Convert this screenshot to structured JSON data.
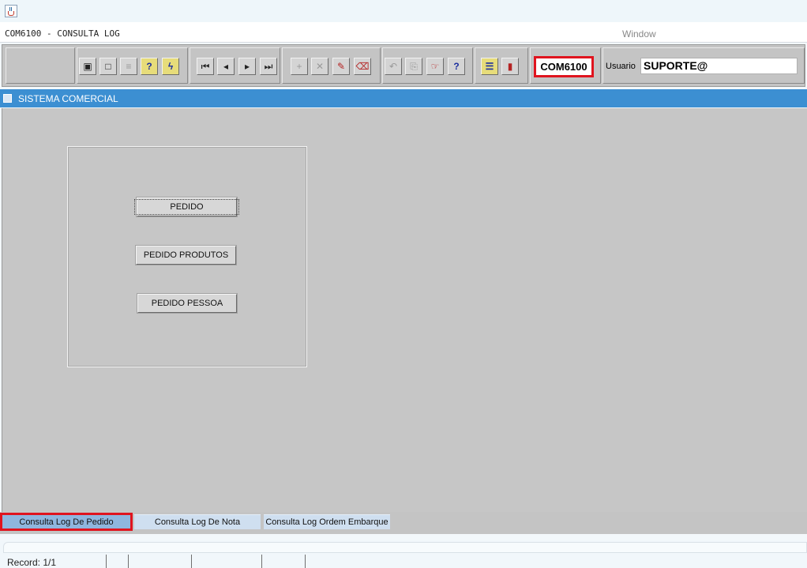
{
  "form": {
    "title": "COM6100 - CONSULTA LOG",
    "window_menu": "Window"
  },
  "toolbar": {
    "buttons": [
      {
        "name": "save",
        "icon": "floppy-icon",
        "glyph": "▣"
      },
      {
        "name": "screen",
        "icon": "monitor-icon",
        "glyph": "□"
      },
      {
        "name": "print",
        "icon": "printer-icon",
        "glyph": "≡"
      },
      {
        "name": "query",
        "icon": "query-icon",
        "glyph": "?"
      },
      {
        "name": "execute-query",
        "icon": "execute-query-icon",
        "glyph": "ϟ"
      },
      {
        "name": "first-record",
        "icon": "first-record-icon",
        "glyph": "⏮"
      },
      {
        "name": "previous-record",
        "icon": "previous-record-icon",
        "glyph": "◂"
      },
      {
        "name": "next-record",
        "icon": "next-record-icon",
        "glyph": "▸"
      },
      {
        "name": "last-record",
        "icon": "last-record-icon",
        "glyph": "⏭"
      },
      {
        "name": "insert-record",
        "icon": "insert-icon",
        "glyph": "+"
      },
      {
        "name": "delete-record",
        "icon": "delete-icon",
        "glyph": "✕"
      },
      {
        "name": "edit-record",
        "icon": "edit-icon",
        "glyph": "✎"
      },
      {
        "name": "clear-record",
        "icon": "eraser-icon",
        "glyph": "⌫"
      },
      {
        "name": "undo",
        "icon": "undo-icon",
        "glyph": "↶"
      },
      {
        "name": "list",
        "icon": "clipboard-icon",
        "glyph": "⎘"
      },
      {
        "name": "lookup",
        "icon": "pointing-hand-icon",
        "glyph": "☞"
      },
      {
        "name": "help",
        "icon": "help-icon",
        "glyph": "?"
      },
      {
        "name": "menu",
        "icon": "menu-icon",
        "glyph": "☰"
      },
      {
        "name": "exit",
        "icon": "exit-door-icon",
        "glyph": "▮"
      }
    ],
    "module_code": "COM6100",
    "user_label": "Usuario",
    "user_value": "SUPORTE@"
  },
  "window": {
    "title": "SISTEMA COMERCIAL"
  },
  "buttons": {
    "pedido": "PEDIDO",
    "pedido_produtos": "PEDIDO PRODUTOS",
    "pedido_pessoa": "PEDIDO PESSOA"
  },
  "tabs": [
    {
      "label": "Consulta Log De Pedido",
      "active": true
    },
    {
      "label": "Consulta Log De Nota",
      "active": false
    },
    {
      "label": "Consulta Log Ordem Embarque",
      "active": false
    }
  ],
  "status": {
    "record": "Record: 1/1"
  },
  "colors": {
    "window_title_bg": "#3c8fd2",
    "highlight_border": "#e0141e",
    "canvas_bg": "#c6c6c6",
    "active_tab_bg": "#8fb6de"
  }
}
